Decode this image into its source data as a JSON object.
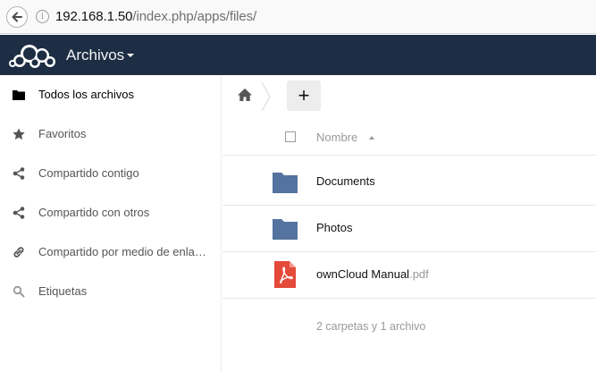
{
  "browser": {
    "url_host": "192.168.1.50",
    "url_path": "/index.php/apps/files/"
  },
  "header": {
    "app_name": "Archivos"
  },
  "sidebar": {
    "items": [
      {
        "label": "Todos los archivos",
        "icon": "folder-icon",
        "active": true
      },
      {
        "label": "Favoritos",
        "icon": "star-icon",
        "active": false
      },
      {
        "label": "Compartido contigo",
        "icon": "share-icon",
        "active": false
      },
      {
        "label": "Compartido con otros",
        "icon": "share-icon",
        "active": false
      },
      {
        "label": "Compartido por medio de enla…",
        "icon": "link-icon",
        "active": false
      },
      {
        "label": "Etiquetas",
        "icon": "search-icon",
        "active": false
      }
    ]
  },
  "main": {
    "new_button_label": "+",
    "column_name": "Nombre",
    "files": [
      {
        "name": "Documents",
        "ext": "",
        "icon": "folder-icon"
      },
      {
        "name": "Photos",
        "ext": "",
        "icon": "folder-icon"
      },
      {
        "name": "ownCloud Manual",
        "ext": ".pdf",
        "icon": "pdf-icon"
      }
    ],
    "summary": "2 carpetas y 1 archivo"
  },
  "colors": {
    "header_bg": "#1d2d44",
    "folder": "#54739e",
    "pdf": "#e34a3a"
  }
}
